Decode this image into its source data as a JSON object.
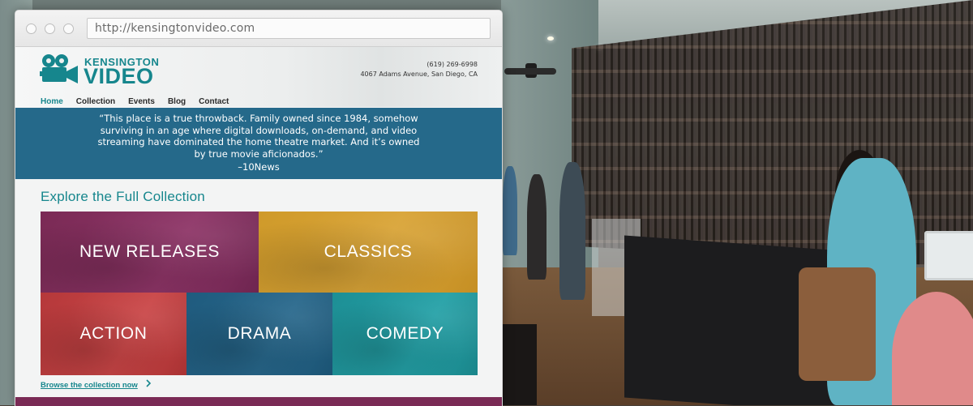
{
  "browser": {
    "url": "http://kensingtonvideo.com"
  },
  "header": {
    "logo_top": "KENSINGTON",
    "logo_bottom": "VIDEO",
    "phone": "(619) 269-6998",
    "address": "4067 Adams Avenue, San Diego, CA"
  },
  "nav": {
    "items": [
      "Home",
      "Collection",
      "Events",
      "Blog",
      "Contact"
    ],
    "active": "Home"
  },
  "quote": {
    "text": "“This place is a true throwback. Family owned since 1984, somehow surviving in an age where digital downloads, on-demand, and video streaming have dominated the home theatre market. And it’s owned by true movie aficionados.”",
    "source": "–10News"
  },
  "collection": {
    "heading": "Explore the Full Collection",
    "tiles": [
      {
        "label": "NEW RELEASES",
        "color": "#8d3466"
      },
      {
        "label": "CLASSICS",
        "color": "#d9a437"
      },
      {
        "label": "ACTION",
        "color": "#c94546"
      },
      {
        "label": "DRAMA",
        "color": "#27678b"
      },
      {
        "label": "COMEDY",
        "color": "#23a0a6"
      }
    ],
    "browse_link": "Browse the collection now",
    "browse_icon": "chevron-right-icon"
  },
  "colors": {
    "brand_teal": "#16868d",
    "quote_band": "#25698a",
    "footer_band": "#7a2a55"
  }
}
